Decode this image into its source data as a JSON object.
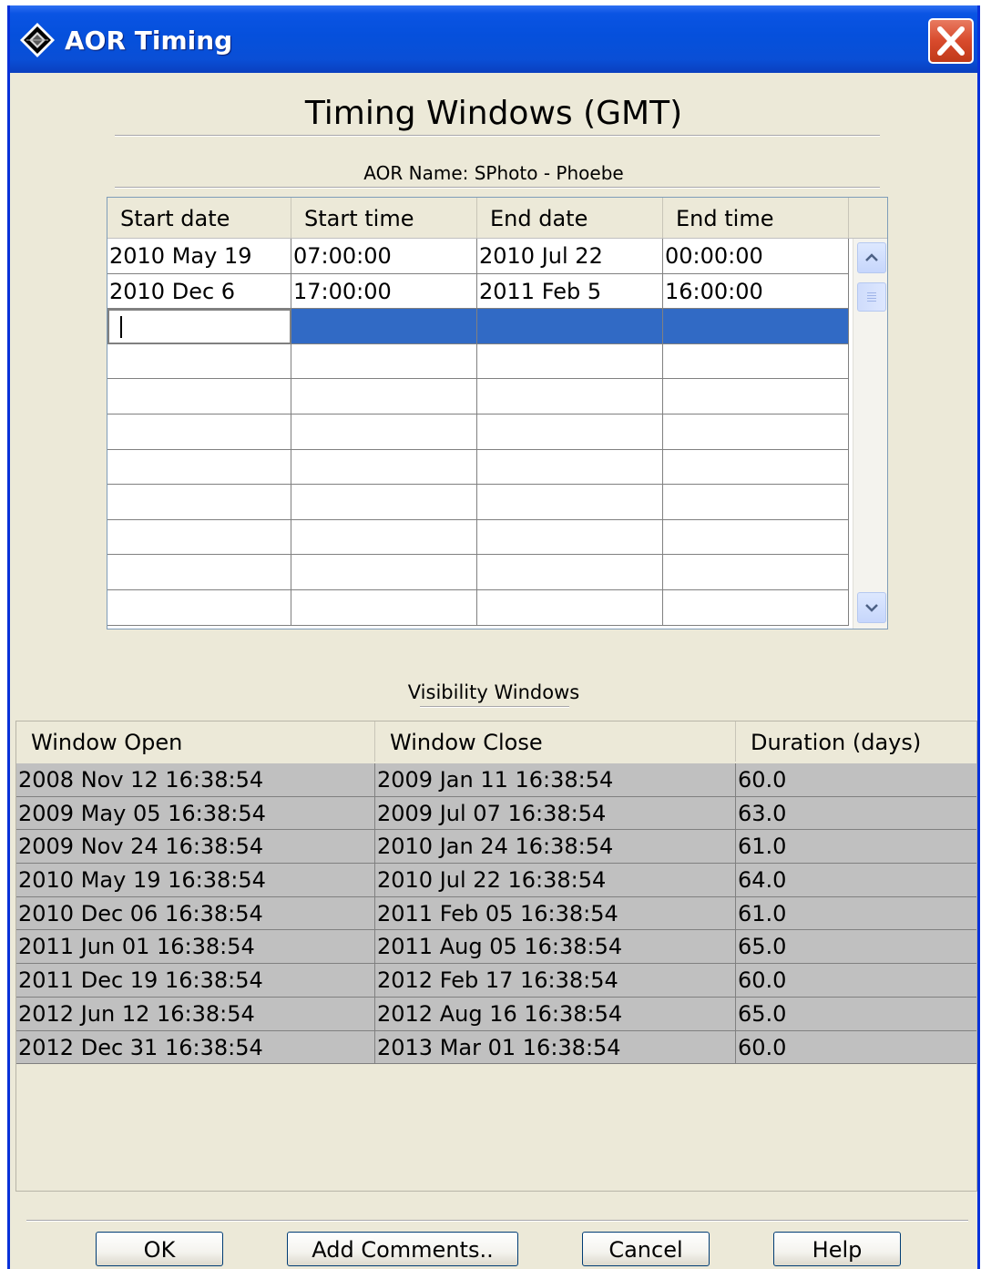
{
  "window": {
    "title": "AOR Timing"
  },
  "dialog": {
    "heading": "Timing Windows (GMT)",
    "aor_name_label": "AOR Name:",
    "aor_name_value": "SPhoto - Phoebe"
  },
  "timing_table": {
    "columns": [
      "Start date",
      "Start time",
      "End date",
      "End time"
    ],
    "rows": [
      [
        "2010 May 19",
        "07:00:00",
        "2010 Jul 22",
        "00:00:00"
      ],
      [
        "2010 Dec 6",
        "17:00:00",
        "2011 Feb 5",
        "16:00:00"
      ],
      [
        "",
        "",
        "",
        ""
      ],
      [
        "",
        "",
        "",
        ""
      ],
      [
        "",
        "",
        "",
        ""
      ],
      [
        "",
        "",
        "",
        ""
      ],
      [
        "",
        "",
        "",
        ""
      ],
      [
        "",
        "",
        "",
        ""
      ],
      [
        "",
        "",
        "",
        ""
      ],
      [
        "",
        "",
        "",
        ""
      ],
      [
        "",
        "",
        "",
        ""
      ]
    ],
    "selected_row": 2
  },
  "visibility": {
    "label": "Visibility Windows",
    "columns": [
      "Window Open",
      "Window Close",
      "Duration (days)"
    ],
    "rows": [
      [
        "2008 Nov 12 16:38:54",
        "2009 Jan 11 16:38:54",
        "60.0"
      ],
      [
        "2009 May 05 16:38:54",
        "2009 Jul 07 16:38:54",
        "63.0"
      ],
      [
        "2009 Nov 24 16:38:54",
        "2010 Jan 24 16:38:54",
        "61.0"
      ],
      [
        "2010 May 19 16:38:54",
        "2010 Jul 22 16:38:54",
        "64.0"
      ],
      [
        "2010 Dec 06 16:38:54",
        "2011 Feb 05 16:38:54",
        "61.0"
      ],
      [
        "2011 Jun 01 16:38:54",
        "2011 Aug 05 16:38:54",
        "65.0"
      ],
      [
        "2011 Dec 19 16:38:54",
        "2012 Feb 17 16:38:54",
        "60.0"
      ],
      [
        "2012 Jun 12 16:38:54",
        "2012 Aug 16 16:38:54",
        "65.0"
      ],
      [
        "2012 Dec 31 16:38:54",
        "2013 Mar 01 16:38:54",
        "60.0"
      ]
    ]
  },
  "buttons": {
    "ok": "OK",
    "add_comments": "Add Comments..",
    "cancel": "Cancel",
    "help": "Help"
  },
  "icons": {
    "app": "app-diamond-icon",
    "close": "close-icon",
    "scroll_up": "chevron-up-icon",
    "scroll_down": "chevron-down-icon"
  },
  "colors": {
    "titlebar": "#0a54e3",
    "selection": "#316ac5",
    "dialog_bg": "#ece9d8",
    "visibility_rows": "#c0c0c0",
    "close_button": "#d84a2c"
  }
}
